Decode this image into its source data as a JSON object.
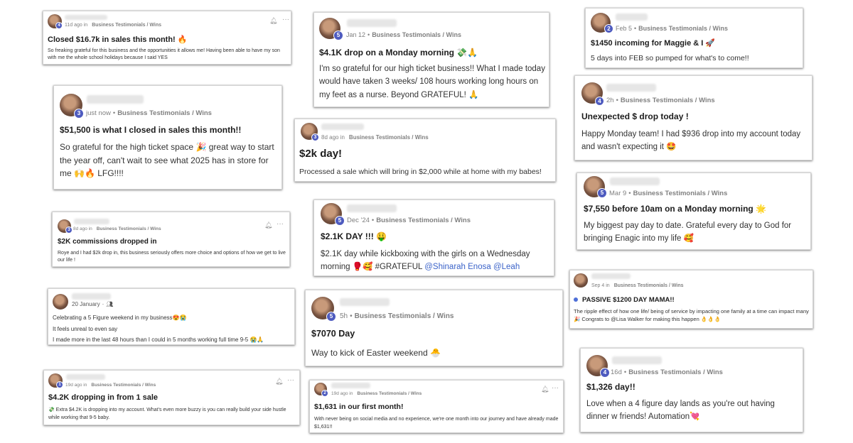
{
  "posts": [
    {
      "time": "11d ago in",
      "category": "Business Testimonials / Wins",
      "level": "4",
      "title": "Closed $16.7k in sales this month!",
      "emoji": "🔥",
      "body": "So freaking grateful for this business and the opportunities it allows me! Having been able to have my son with me the whole school holidays because I said YES"
    },
    {
      "time": "Jan 12",
      "category": "Business Testimonials / Wins",
      "level": "5",
      "title": "$4.1K drop on a Monday morning",
      "emoji": "💸🙏",
      "body": "I'm so grateful for our high ticket business!! What I made today would have taken 3 weeks/ 108 hours working long hours on my feet as a nurse. Beyond GRATEFUL! 🙏"
    },
    {
      "time": "Feb 5",
      "category": "Business Testimonials / Wins",
      "level": "2",
      "title": "$1450 incoming for Maggie & I",
      "emoji": "🚀",
      "body": "5 days into FEB so pumped for what's to come!!"
    },
    {
      "time": "just now",
      "category": "Business Testimonials / Wins",
      "level": "3",
      "title": "$51,500 is what I closed in sales this month!!",
      "emoji": "",
      "body": "So grateful for the high ticket space 🎉 great way to start the year off, can't wait to see what 2025 has in store for me 🙌🔥 LFG!!!!"
    },
    {
      "time": "8d ago in",
      "category": "Business Testimonials / Wins",
      "level": "3",
      "title": "$2k day!",
      "emoji": "",
      "body": "Processed a sale which will bring in $2,000 while at home with my babes!"
    },
    {
      "time": "2h",
      "category": "Business Testimonials / Wins",
      "level": "4",
      "title": "Unexpected $ drop today !",
      "emoji": "",
      "body": "Happy Monday team! I had $936 drop into my account today and wasn't expecting it 🤩"
    },
    {
      "time": "8d ago in",
      "category": "Business Testimonials / Wins",
      "level": "3",
      "title": "$2K commissions dropped in",
      "emoji": "",
      "body": "Roye and I had $2k drop in, this business seriously offers more choice and options of how we get to live our life !"
    },
    {
      "time": "Dec '24",
      "category": "Business Testimonials / Wins",
      "level": "5",
      "title": "$2.1K DAY !!!",
      "emoji": "🤑",
      "body_pre": "$2.1K day while kickboxing with the girls on a Wednesday morning 🥊🥰 #GRATEFUL ",
      "mention1": "@Shinarah Enosa",
      "mention2": "@Leah"
    },
    {
      "time": "Mar 9",
      "category": "Business Testimonials / Wins",
      "level": "5",
      "title": "$7,550 before 10am on a Monday morning",
      "emoji": "🌟",
      "body": "My biggest pay day to date. Grateful every day to God for bringing Enagic into my life 🥰"
    },
    {
      "time": "20 January",
      "category": "",
      "level": "",
      "title": "",
      "emoji": "",
      "lines": [
        "Celebrating a 5 Figure weekend in my business😍😭",
        "It feels unreal to even say",
        "I made more in the last 48 hours than I could in 5 months working full time 9-5 😭🙏"
      ]
    },
    {
      "time": "5h",
      "category": "Business Testimonials / Wins",
      "level": "5",
      "title": "$7070 Day",
      "emoji": "",
      "body": "Way to kick of Easter weekend 🐣"
    },
    {
      "time": "Sep 4 in",
      "category": "Business Testimonials / Wins",
      "level": "",
      "title": "PASSIVE $1200 DAY MAMA!!",
      "emoji": "",
      "body": "The ripple effect of how one life/ being of service by impacting one family at a time can impact many 🎉 Congrats to @Lisa Walker for making this happen 👌👌👌"
    },
    {
      "time": "16d",
      "category": "Business Testimonials / Wins",
      "level": "4",
      "title": "$1,326 day!!",
      "emoji": "",
      "body": "Love when a 4 figure day lands as you're out having dinner w friends! Automation💘"
    },
    {
      "time": "19d ago in",
      "category": "Business Testimonials / Wins",
      "level": "1",
      "title": "$4.2K dropping in from 1 sale",
      "emoji": "",
      "body": "💸 Extra $4.2K is dropping into my account. What's even more buzzy is you can really build your side hustle while working that 9-5 baby."
    },
    {
      "time": "19d ago in",
      "category": "Business Testimonials / Wins",
      "level": "2",
      "title": "$1,631 in our first month!",
      "emoji": "",
      "body": "With never being on social media and no experience, we're one month into our journey and have already made $1,631!!"
    }
  ],
  "icons": {
    "bell": "bell-icon",
    "more": "more-icon",
    "group": "group-icon"
  }
}
